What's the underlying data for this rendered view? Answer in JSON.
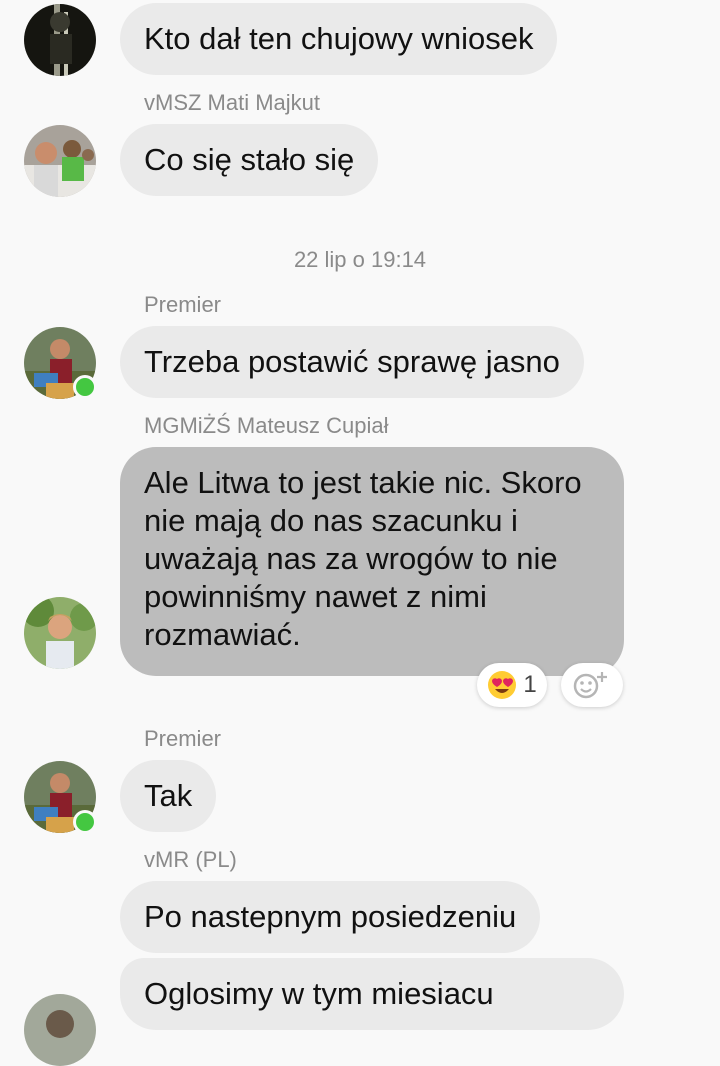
{
  "messages": [
    {
      "text": "Kto dał ten chujowy wniosek"
    },
    {
      "sender": "vMSZ Mati Majkut",
      "text": "Co się stało się"
    },
    {
      "sender": "Premier",
      "text": "Trzeba postawić sprawę jasno"
    },
    {
      "sender": "MGMiŻŚ Mateusz Cupiał",
      "text": "Ale Litwa to jest takie nic. Skoro nie mają do nas szacunku i uważają nas za wrogów to nie powinniśmy nawet z nimi rozmawiać."
    },
    {
      "sender": "Premier",
      "text": "Tak"
    },
    {
      "sender": "vMR (PL)",
      "text": "Po nastepnym posiedzeniu"
    },
    {
      "text": "Oglosimy w tym miesiacu"
    }
  ],
  "timestamp": "22 lip o 19:14",
  "reaction": {
    "emoji": "heart-eyes-emoji",
    "count": "1"
  },
  "add_reaction_icon": "add-reaction-icon",
  "colors": {
    "background": "#f9f9f9",
    "bubble": "#eaeaea",
    "highlighted_bubble": "#bcbcbc",
    "meta_text": "#8a8a8a",
    "presence": "#44c741"
  }
}
